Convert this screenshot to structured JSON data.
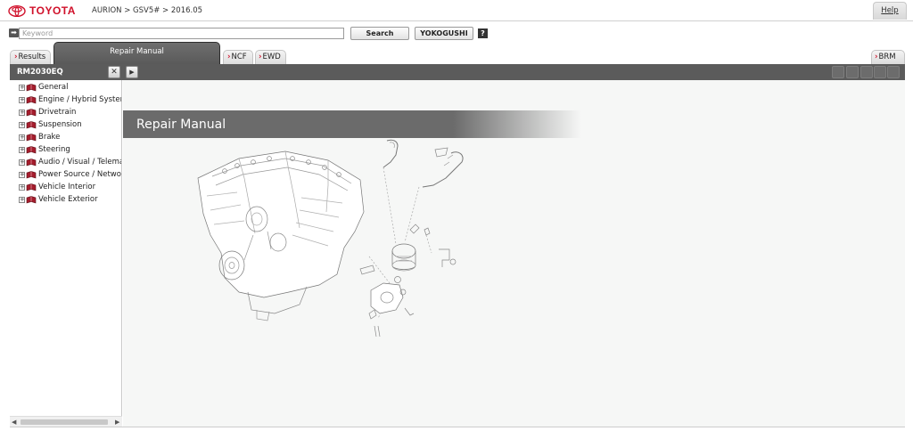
{
  "header": {
    "brand": "TOYOTA",
    "breadcrumb": "AURION > GSV5# > 2016.05",
    "help_label": "Help"
  },
  "search": {
    "placeholder": "Keyword",
    "search_label": "Search",
    "yokogushi_label": "YOKOGUSHI",
    "help_q": "?"
  },
  "tabs": {
    "results": "Results",
    "repair_manual": "Repair Manual",
    "ncf": "NCF",
    "ewd": "EWD",
    "brm": "BRM"
  },
  "toolbar": {
    "doc_code": "RM2030EQ"
  },
  "tree": {
    "items": [
      {
        "label": "General"
      },
      {
        "label": "Engine / Hybrid System"
      },
      {
        "label": "Drivetrain"
      },
      {
        "label": "Suspension"
      },
      {
        "label": "Brake"
      },
      {
        "label": "Steering"
      },
      {
        "label": "Audio / Visual / Telematics"
      },
      {
        "label": "Power Source / Network"
      },
      {
        "label": "Vehicle Interior"
      },
      {
        "label": "Vehicle Exterior"
      }
    ]
  },
  "content": {
    "banner_title": "Repair Manual"
  },
  "colors": {
    "brand_red": "#d0102a",
    "toolbar_gray": "#5b5b5b",
    "banner_gray": "#6b6b6b"
  }
}
